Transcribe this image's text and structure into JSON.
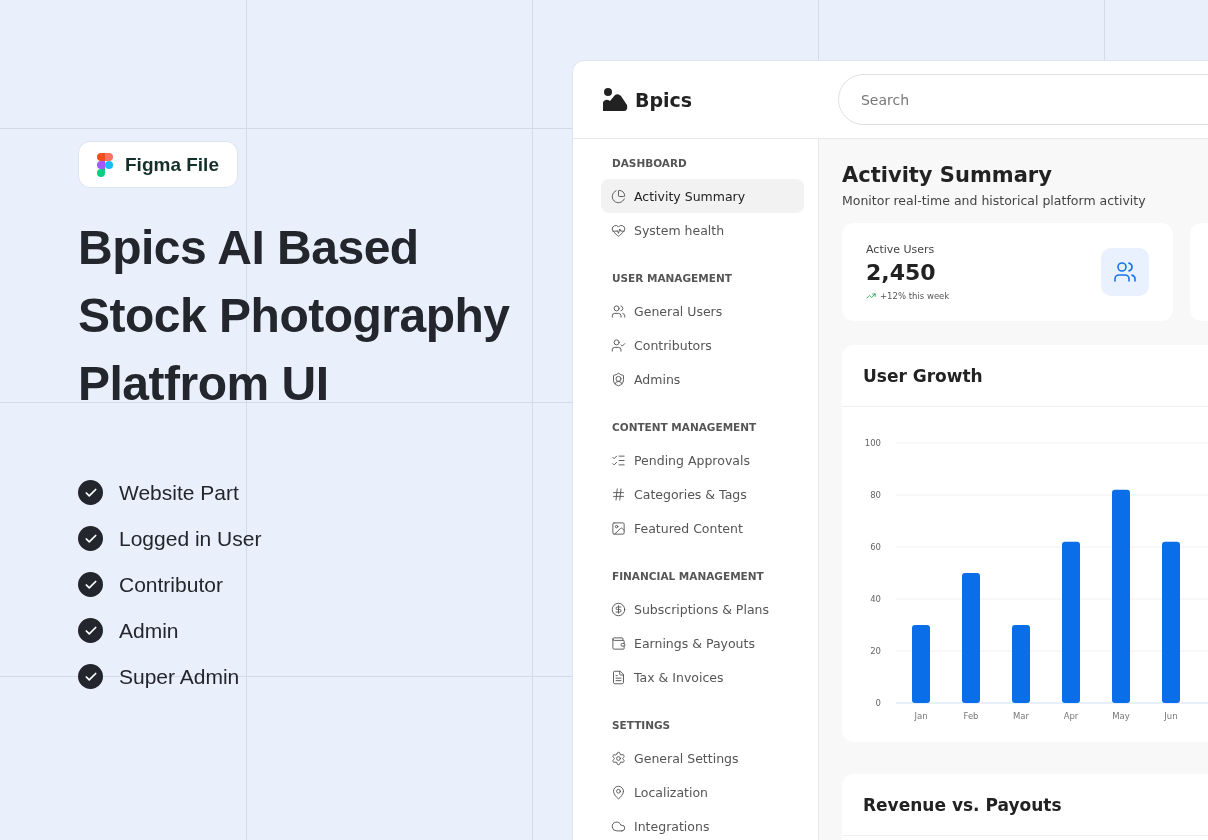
{
  "promo": {
    "badge": "Figma File",
    "title": "Bpics AI Based Stock Photography Platfrom UI",
    "features": [
      {
        "label": "Website Part",
        "checked": true
      },
      {
        "label": "Logged in User",
        "checked": true
      },
      {
        "label": "Contributor",
        "checked": true
      },
      {
        "label": "Admin",
        "checked": true
      },
      {
        "label": "Super Admin",
        "checked": true
      }
    ]
  },
  "app": {
    "brand": "Bpics",
    "search": {
      "placeholder": "Search"
    },
    "sidebar": {
      "sections": [
        {
          "heading": "DASHBOARD",
          "items": [
            {
              "label": "Activity Summary",
              "selected": true
            },
            {
              "label": "System health",
              "selected": false
            }
          ]
        },
        {
          "heading": "USER MANAGEMENT",
          "items": [
            {
              "label": "General Users",
              "selected": false
            },
            {
              "label": "Contributors",
              "selected": false
            },
            {
              "label": "Admins",
              "selected": false
            }
          ]
        },
        {
          "heading": "CONTENT MANAGEMENT",
          "items": [
            {
              "label": "Pending Approvals",
              "selected": false
            },
            {
              "label": "Categories & Tags",
              "selected": false
            },
            {
              "label": "Featured Content",
              "selected": false
            }
          ]
        },
        {
          "heading": "FINANCIAL MANAGEMENT",
          "items": [
            {
              "label": "Subscriptions & Plans",
              "selected": false
            },
            {
              "label": "Earnings & Payouts",
              "selected": false
            },
            {
              "label": "Tax & Invoices",
              "selected": false
            }
          ]
        },
        {
          "heading": "SETTINGS",
          "items": [
            {
              "label": "General Settings",
              "selected": false
            },
            {
              "label": "Localization",
              "selected": false
            },
            {
              "label": "Integrations",
              "selected": false
            }
          ]
        }
      ]
    },
    "page": {
      "title": "Activity Summary",
      "subtitle": "Monitor real-time and historical platform activity"
    },
    "stats": [
      {
        "label": "Active Users",
        "value": "2,450",
        "trend": "+12% this week"
      }
    ],
    "user_growth": {
      "title": "User Growth",
      "chart_data": {
        "type": "bar",
        "categories": [
          "Jan",
          "Feb",
          "Mar",
          "Apr",
          "May",
          "Jun"
        ],
        "series": [
          {
            "color": "#0a6ee8",
            "values": [
              30,
              50,
              30,
              62,
              82,
              62
            ]
          }
        ],
        "grid": true,
        "ylim": [
          0,
          100
        ],
        "yticks": [
          0,
          20,
          40,
          60,
          80,
          100
        ]
      }
    },
    "revenue": {
      "title": "Revenue vs. Payouts"
    }
  }
}
